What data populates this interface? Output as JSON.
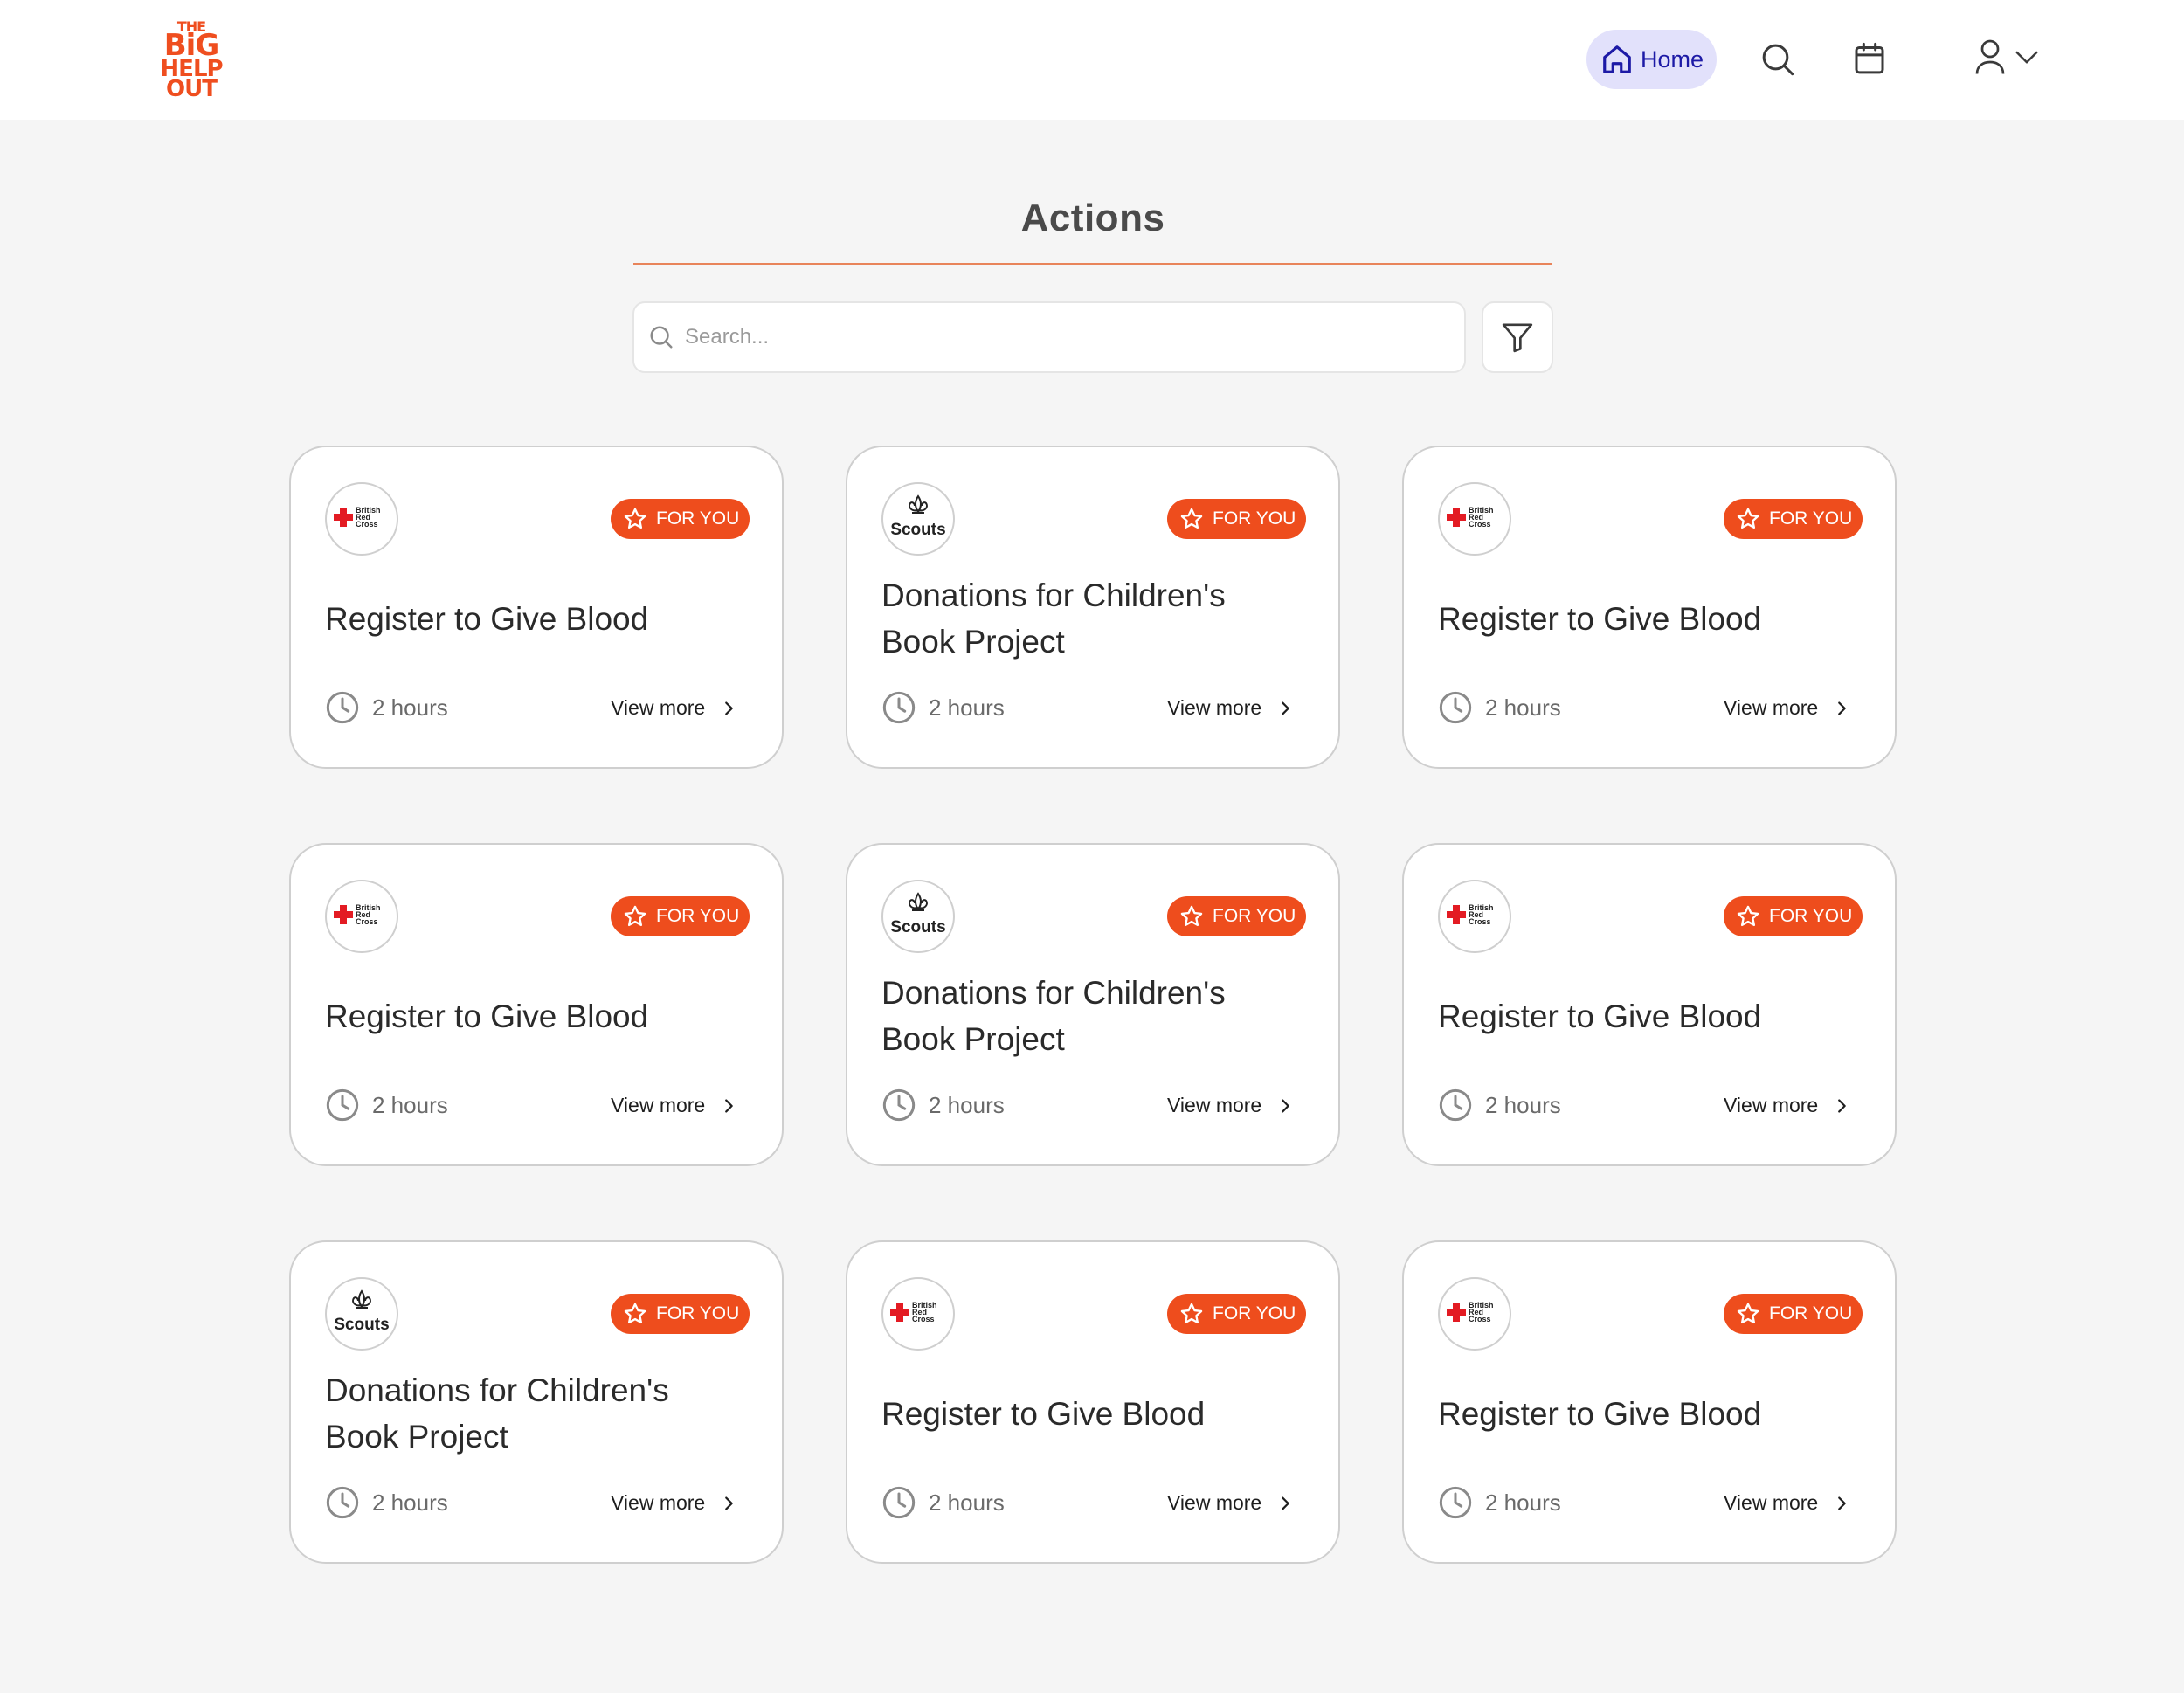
{
  "header": {
    "logo_lines": [
      "THE",
      "BiG",
      "HELP",
      "OUT"
    ],
    "home_label": "Home",
    "icons": [
      "home-icon",
      "search-icon",
      "calendar-icon",
      "user-icon",
      "chevron-down-icon"
    ]
  },
  "main": {
    "title": "Actions",
    "search_placeholder": "Search...",
    "filter_icon": "filter-icon"
  },
  "colors": {
    "accent": "#ee4d1d",
    "nav_active_bg": "#e2e1fb",
    "nav_active_text": "#1d1aa6",
    "page_bg": "#f5f5f5"
  },
  "cards": [
    {
      "org": "British Red Cross",
      "badge": "FOR YOU",
      "title": "Register to Give Blood",
      "duration": "2 hours",
      "link": "View more"
    },
    {
      "org": "Scouts",
      "badge": "FOR YOU",
      "title": "Donations for Children's Book Project",
      "duration": "2 hours",
      "link": "View more"
    },
    {
      "org": "British Red Cross",
      "badge": "FOR YOU",
      "title": "Register to Give Blood",
      "duration": "2 hours",
      "link": "View more"
    },
    {
      "org": "British Red Cross",
      "badge": "FOR YOU",
      "title": "Register to Give Blood",
      "duration": "2 hours",
      "link": "View more"
    },
    {
      "org": "Scouts",
      "badge": "FOR YOU",
      "title": "Donations for Children's Book Project",
      "duration": "2 hours",
      "link": "View more"
    },
    {
      "org": "British Red Cross",
      "badge": "FOR YOU",
      "title": "Register to Give Blood",
      "duration": "2 hours",
      "link": "View more"
    },
    {
      "org": "Scouts",
      "badge": "FOR YOU",
      "title": "Donations for Children's Book Project",
      "duration": "2 hours",
      "link": "View more"
    },
    {
      "org": "British Red Cross",
      "badge": "FOR YOU",
      "title": "Register to Give Blood",
      "duration": "2 hours",
      "link": "View more"
    },
    {
      "org": "British Red Cross",
      "badge": "FOR YOU",
      "title": "Register to Give Blood",
      "duration": "2 hours",
      "link": "View more"
    }
  ]
}
